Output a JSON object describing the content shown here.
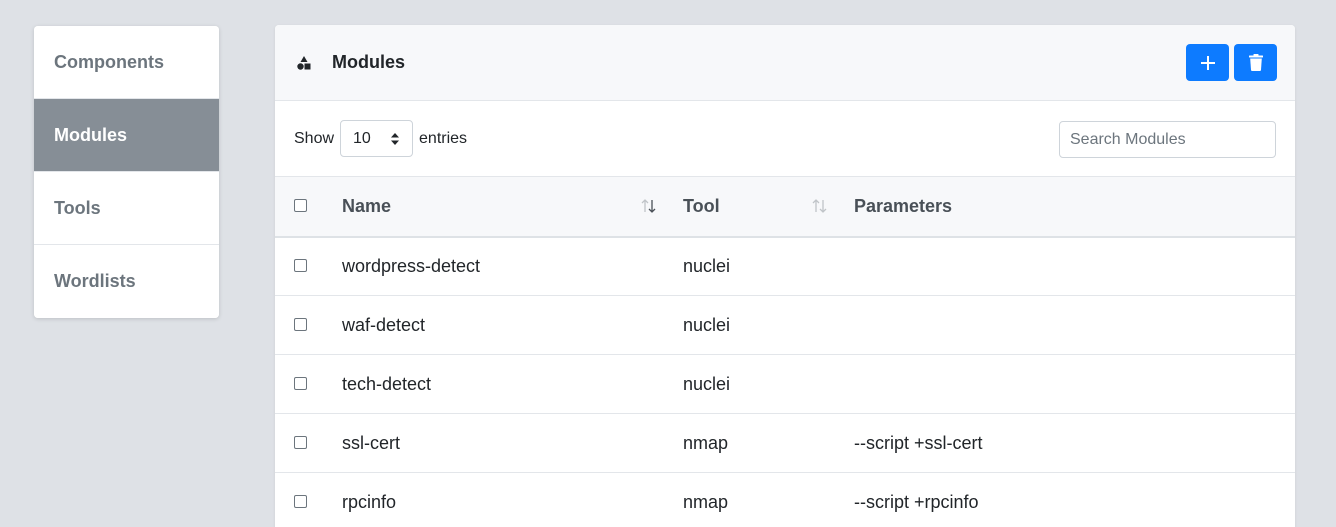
{
  "sidebar": {
    "items": [
      {
        "label": "Components",
        "active": false
      },
      {
        "label": "Modules",
        "active": true
      },
      {
        "label": "Tools",
        "active": false
      },
      {
        "label": "Wordlists",
        "active": false
      }
    ]
  },
  "card": {
    "title": "Modules",
    "title_icon": "shapes-icon",
    "add_icon": "plus-icon",
    "delete_icon": "trash-icon",
    "accent_color": "#0d7bff"
  },
  "controls": {
    "show_label": "Show",
    "entries_value": "10",
    "entries_label": "entries",
    "search_placeholder": "Search Modules"
  },
  "table": {
    "headers": {
      "name": "Name",
      "tool": "Tool",
      "parameters": "Parameters"
    },
    "rows": [
      {
        "name": "wordpress-detect",
        "tool": "nuclei",
        "parameters": ""
      },
      {
        "name": "waf-detect",
        "tool": "nuclei",
        "parameters": ""
      },
      {
        "name": "tech-detect",
        "tool": "nuclei",
        "parameters": ""
      },
      {
        "name": "ssl-cert",
        "tool": "nmap",
        "parameters": "--script +ssl-cert"
      },
      {
        "name": "rpcinfo",
        "tool": "nmap",
        "parameters": "--script +rpcinfo"
      }
    ]
  }
}
